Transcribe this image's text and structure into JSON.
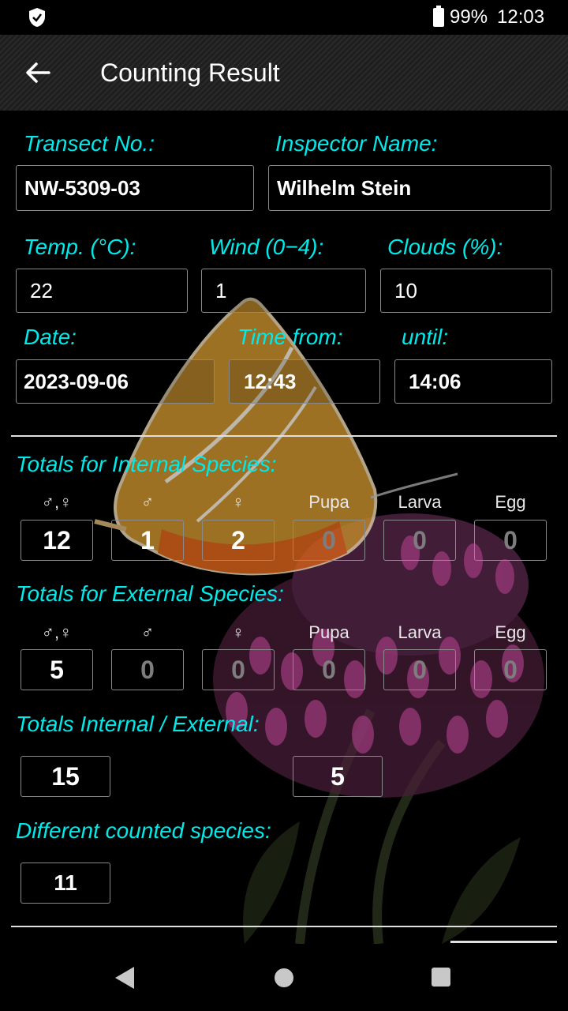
{
  "status_bar": {
    "battery": "99%",
    "time": "12:03"
  },
  "toolbar": {
    "title": "Counting Result"
  },
  "form": {
    "transect_label": "Transect No.:",
    "transect_value": "NW-5309-03",
    "inspector_label": "Inspector Name:",
    "inspector_value": "Wilhelm Stein",
    "temp_label": "Temp. (°C):",
    "temp_value": "22",
    "wind_label": "Wind (0−4):",
    "wind_value": "1",
    "clouds_label": "Clouds (%):",
    "clouds_value": "10",
    "date_label": "Date:",
    "date_value": "2023-09-06",
    "time_from_label": "Time from:",
    "time_from_value": "12:43",
    "until_label": "until:",
    "until_value": "14:06"
  },
  "columns": [
    "♂,♀",
    "♂",
    "♀",
    "Pupa",
    "Larva",
    "Egg"
  ],
  "internal": {
    "title": "Totals for Internal Species:",
    "values": [
      "12",
      "1",
      "2",
      "0",
      "0",
      "0"
    ]
  },
  "external": {
    "title": "Totals for External Species:",
    "values": [
      "5",
      "0",
      "0",
      "0",
      "0",
      "0"
    ]
  },
  "int_ext": {
    "title": "Totals Internal / External:",
    "internal": "15",
    "external": "5"
  },
  "different": {
    "title": "Different counted species:",
    "value": "11"
  },
  "icons": {
    "back": "arrow-left-icon",
    "status": "shield-icon",
    "battery": "battery-icon",
    "nav_back": "nav-back-icon",
    "nav_home": "nav-home-icon",
    "nav_recent": "nav-recent-icon"
  },
  "colors": {
    "label": "#00eaea",
    "background": "#000000",
    "dim_value": "#7d7d7d"
  }
}
